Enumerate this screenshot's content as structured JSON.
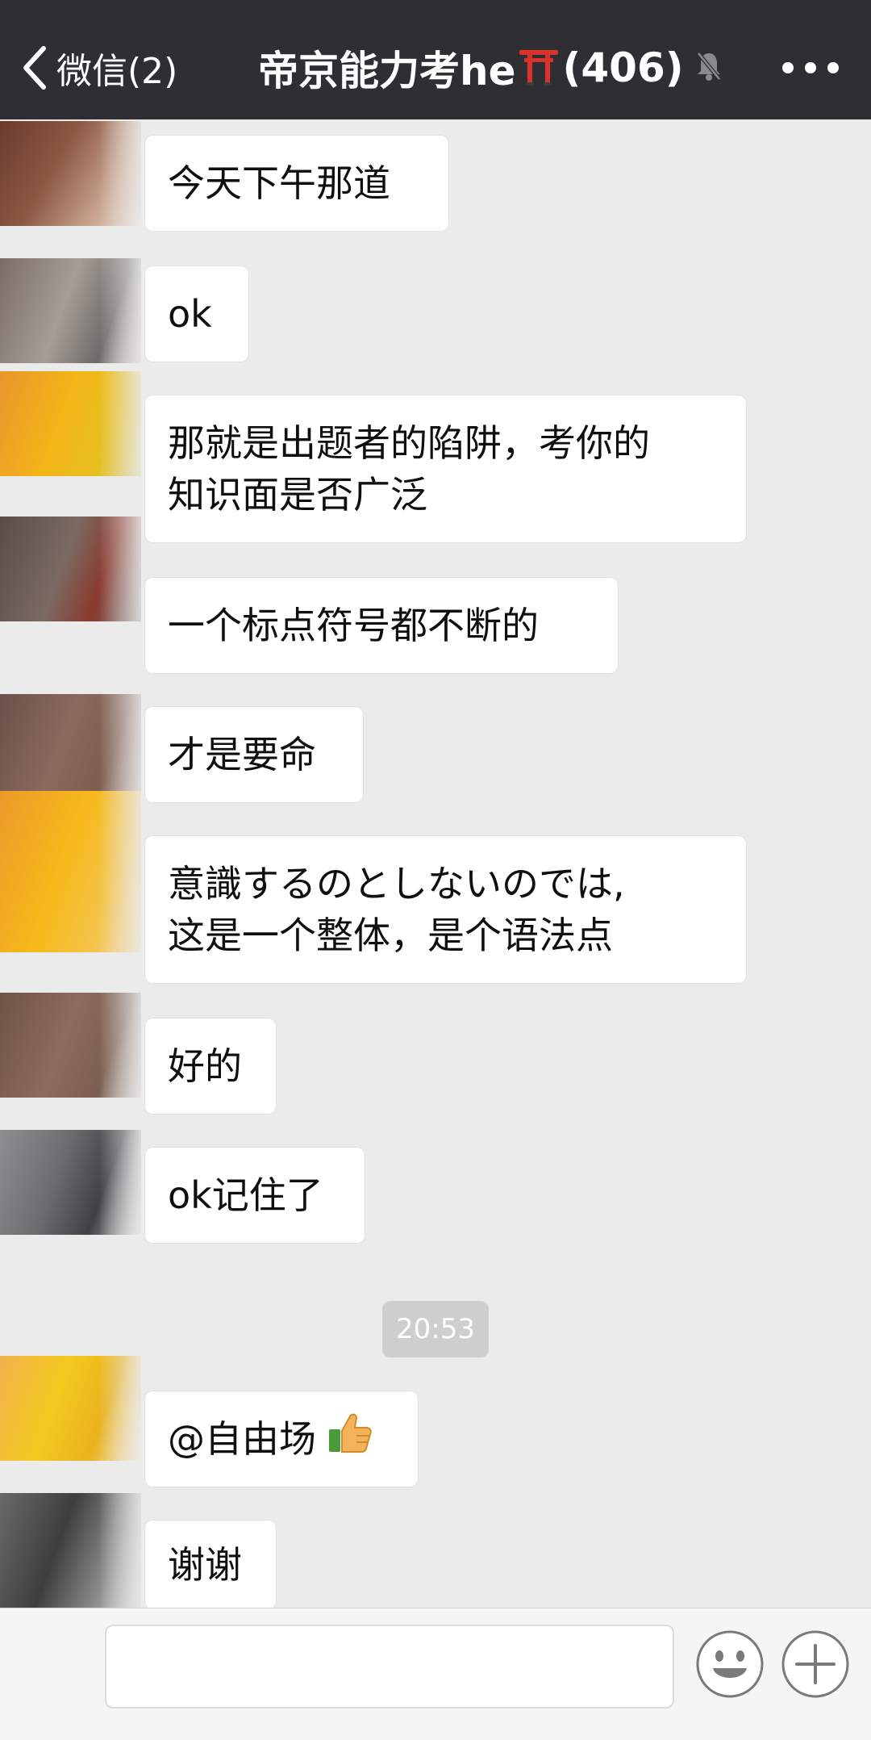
{
  "header": {
    "back_label": "微信(2)",
    "title": "帝京能力考he",
    "title_count": "(406)"
  },
  "messages": [
    {
      "text": "今天下午那道"
    },
    {
      "text": "ok"
    },
    {
      "lines": [
        "那就是出题者的陷阱，考你的",
        "知识面是否广泛"
      ]
    },
    {
      "text": "一个标点符号都不断的"
    },
    {
      "text": "才是要命"
    },
    {
      "lines": [
        "意識するのとしないのでは,",
        "这是一个整体，是个语法点"
      ]
    },
    {
      "text": "好的"
    },
    {
      "text": "ok记住了"
    },
    {
      "text": "@自由场"
    },
    {
      "text": "谢谢"
    }
  ],
  "timestamp": "20:53",
  "icons": {
    "back": "chevron-left-icon",
    "title_emoji": "torii-gate-icon",
    "mute": "bell-off-icon",
    "more": "more-dots-icon",
    "thumbs": "thumbs-up-icon",
    "emoji": "emoji-icon",
    "plus": "plus-icon"
  },
  "colors": {
    "header_bg": "#2f2e33",
    "chat_bg": "#ebebeb",
    "bubble_bg": "#ffffff",
    "timestamp_bg": "#cecece"
  }
}
